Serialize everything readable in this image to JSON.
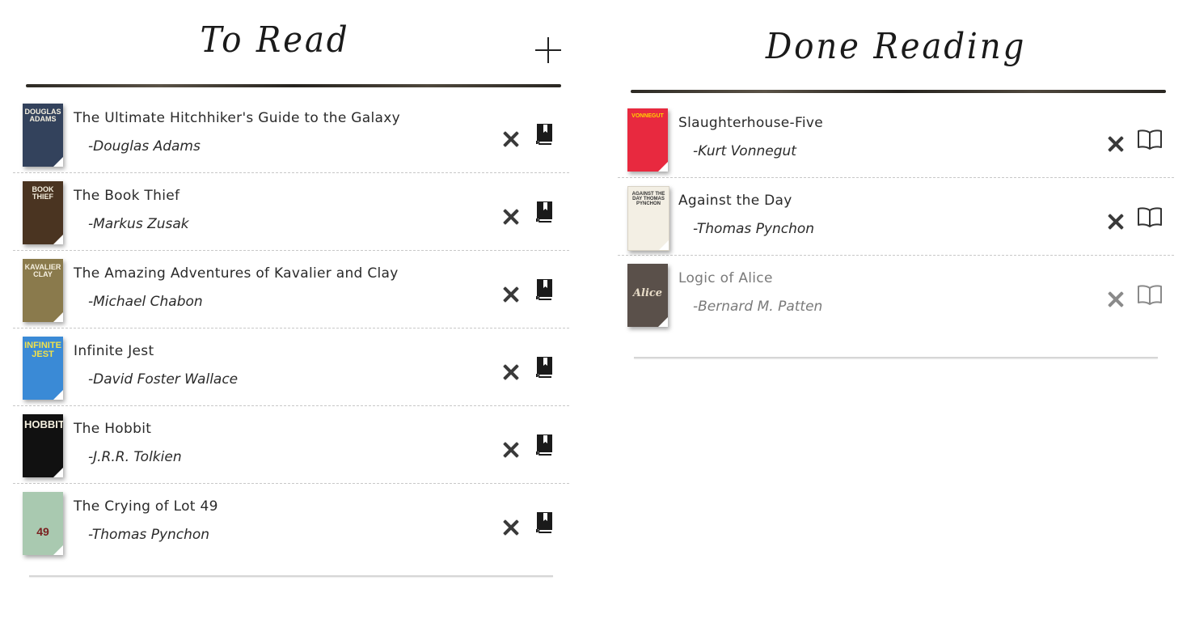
{
  "to_read": {
    "title": "To Read",
    "add_icon": "plus-icon",
    "action_icon": "bookmark-icon",
    "delete_icon": "close-icon",
    "books": [
      {
        "title": "The Ultimate Hitchhiker's Guide to the Galaxy",
        "author": "-Douglas Adams",
        "cover_color": "#33425c",
        "cover_text": "DOUGLAS ADAMS"
      },
      {
        "title": "The Book Thief",
        "author": "-Markus Zusak",
        "cover_color": "#4a3421",
        "cover_text": "BOOK THIEF"
      },
      {
        "title": "The Amazing Adventures of Kavalier and Clay",
        "author": "-Michael Chabon",
        "cover_color": "#8a7a4c",
        "cover_text": "KAVALIER CLAY"
      },
      {
        "title": "Infinite Jest",
        "author": "-David Foster Wallace",
        "cover_color": "#3a8ad6",
        "cover_text": "INFINITE JEST"
      },
      {
        "title": "The Hobbit",
        "author": "-J.R.R. Tolkien",
        "cover_color": "#111111",
        "cover_text": "HOBBIT"
      },
      {
        "title": "The Crying of Lot 49",
        "author": "-Thomas Pynchon",
        "cover_color": "#a9c9b0",
        "cover_text": "49"
      }
    ]
  },
  "done_reading": {
    "title": "Done Reading",
    "action_icon": "open-book-icon",
    "delete_icon": "close-icon",
    "books": [
      {
        "title": "Slaughterhouse-Five",
        "author": "-Kurt Vonnegut",
        "cover_color": "#e8293f",
        "cover_text": "VONNEGUT"
      },
      {
        "title": "Against the Day",
        "author": "-Thomas Pynchon",
        "cover_color": "#f3efe4",
        "cover_text": "AGAINST THE DAY THOMAS PYNCHON"
      },
      {
        "title": "Logic of Alice",
        "author": "-Bernard M. Patten",
        "cover_color": "#5a504a",
        "cover_text": "Alice",
        "faded": true
      }
    ]
  }
}
